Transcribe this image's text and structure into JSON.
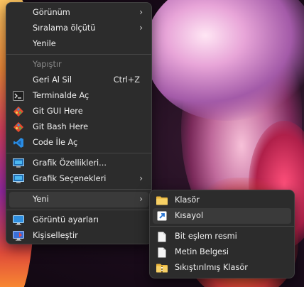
{
  "context_menu": {
    "items": [
      {
        "label": "Görünüm",
        "has_submenu": true
      },
      {
        "label": "Sıralama ölçütü",
        "has_submenu": true
      },
      {
        "label": "Yenile"
      },
      {
        "label": "Yapıştır",
        "disabled": true
      },
      {
        "label": "Geri Al Sil",
        "shortcut": "Ctrl+Z"
      },
      {
        "label": "Terminalde Aç",
        "icon": "terminal-icon"
      },
      {
        "label": "Git GUI Here",
        "icon": "git-icon"
      },
      {
        "label": "Git Bash Here",
        "icon": "git-icon"
      },
      {
        "label": "Code İle Aç",
        "icon": "vscode-icon"
      },
      {
        "label": "Grafik Özellikleri...",
        "icon": "intel-graphics-icon"
      },
      {
        "label": "Grafik Seçenekleri",
        "icon": "intel-graphics-icon",
        "has_submenu": true
      },
      {
        "label": "Yeni",
        "has_submenu": true,
        "highlighted": true
      },
      {
        "label": "Görüntü ayarları",
        "icon": "display-settings-icon"
      },
      {
        "label": "Kişiselleştir",
        "icon": "personalize-icon"
      }
    ],
    "chevron": "›"
  },
  "new_submenu": {
    "items": [
      {
        "label": "Klasör",
        "icon": "folder-icon"
      },
      {
        "label": "Kısayol",
        "icon": "shortcut-icon",
        "highlighted": true
      },
      {
        "label": "Bit eşlem resmi",
        "icon": "file-icon"
      },
      {
        "label": "Metin Belgesi",
        "icon": "file-icon"
      },
      {
        "label": "Sıkıştırılmış Klasör",
        "icon": "zip-folder-icon"
      }
    ]
  },
  "colors": {
    "menu_bg": "#2c2c2c",
    "highlight": "#3a3a3a",
    "vscode_blue": "#2a8ee6",
    "folder_yellow": "#f2c94c"
  }
}
